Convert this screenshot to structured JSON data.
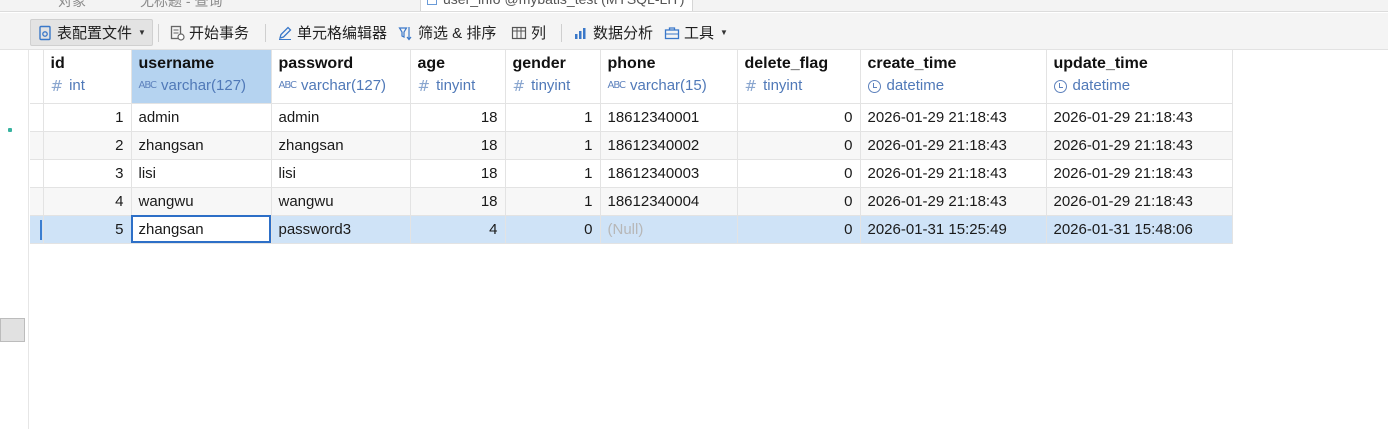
{
  "toolbar": {
    "table_config_label": "表配置文件",
    "begin_tx_label": "开始事务",
    "cell_editor_label": "单元格编辑器",
    "filter_sort_label": "筛选 & 排序",
    "columns_label": "列",
    "data_analysis_label": "数据分析",
    "tools_label": "工具"
  },
  "grid": {
    "columns": [
      {
        "name": "id",
        "type": "int",
        "icon": "hash-icon"
      },
      {
        "name": "username",
        "type": "varchar(127)",
        "icon": "abc-icon"
      },
      {
        "name": "password",
        "type": "varchar(127)",
        "icon": "abc-icon"
      },
      {
        "name": "age",
        "type": "tinyint",
        "icon": "hash-icon"
      },
      {
        "name": "gender",
        "type": "tinyint",
        "icon": "hash-icon"
      },
      {
        "name": "phone",
        "type": "varchar(15)",
        "icon": "abc-icon"
      },
      {
        "name": "delete_flag",
        "type": "tinyint",
        "icon": "hash-icon"
      },
      {
        "name": "create_time",
        "type": "datetime",
        "icon": "clock-icon"
      },
      {
        "name": "update_time",
        "type": "datetime",
        "icon": "clock-icon"
      }
    ],
    "rows": [
      [
        "1",
        "admin",
        "admin",
        "18",
        "1",
        "18612340001",
        "0",
        "2026-01-29 21:18:43",
        "2026-01-29 21:18:43"
      ],
      [
        "2",
        "zhangsan",
        "zhangsan",
        "18",
        "1",
        "18612340002",
        "0",
        "2026-01-29 21:18:43",
        "2026-01-29 21:18:43"
      ],
      [
        "3",
        "lisi",
        "lisi",
        "18",
        "1",
        "18612340003",
        "0",
        "2026-01-29 21:18:43",
        "2026-01-29 21:18:43"
      ],
      [
        "4",
        "wangwu",
        "wangwu",
        "18",
        "1",
        "18612340004",
        "0",
        "2026-01-29 21:18:43",
        "2026-01-29 21:18:43"
      ],
      [
        "5",
        "zhangsan",
        "password3",
        "4",
        "0",
        "(Null)",
        "0",
        "2026-01-31 15:25:49",
        "2026-01-31 15:48:06"
      ]
    ],
    "selected_column": "username",
    "selected_row": "5"
  },
  "colors": {
    "selection": "#b5d3f0",
    "selected_row": "#cfe3f7",
    "type_text": "#5079b8",
    "focus_outline": "#2d6fc7"
  }
}
